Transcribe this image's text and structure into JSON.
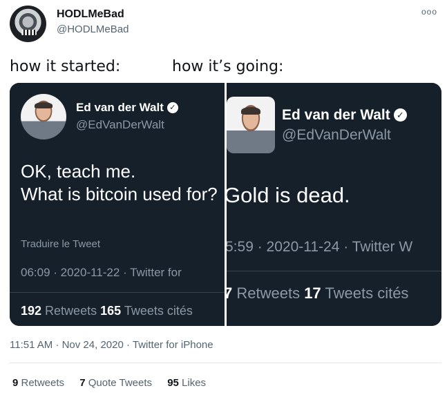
{
  "author": {
    "display_name": "HODLMeBad",
    "handle": "@HODLMeBad",
    "avatar_icon": "skull-avatar-icon"
  },
  "more_glyph": "ooo",
  "caption": {
    "left": "how it started:",
    "right": "how it’s going:"
  },
  "media": {
    "left": {
      "name": "Ed van der Walt",
      "verified_glyph": "✓",
      "handle": "@EdVanDerWalt",
      "text_line1": "OK, teach me.",
      "text_line2": "What is bitcoin used for?",
      "translate": "Traduire le Tweet",
      "meta": "06:09 · 2020-11-22 · Twitter for ",
      "retweets_count": "192",
      "retweets_label": " Retweets ",
      "quotes_count": "165",
      "quotes_label": " Tweets cités"
    },
    "right": {
      "name": "Ed van der Walt",
      "verified_glyph": "✓",
      "handle": "@EdVanDerWalt",
      "text_line1": "Gold is dead.",
      "meta": "5:59 · 2020-11-24 · Twitter W",
      "retweets_count": "7",
      "retweets_label": " Retweets ",
      "quotes_count": "17",
      "quotes_label": " Tweets cités"
    }
  },
  "timestamp": "11:51 AM · Nov 24, 2020 · Twitter for iPhone",
  "stats": {
    "retweets_count": "9",
    "retweets_label": " Retweets",
    "quotes_count": "7",
    "quotes_label": " Quote Tweets",
    "likes_count": "95",
    "likes_label": " Likes"
  },
  "colors": {
    "media_background": "#15202b",
    "secondary_text": "#536471",
    "primary_text": "#0f1419"
  }
}
